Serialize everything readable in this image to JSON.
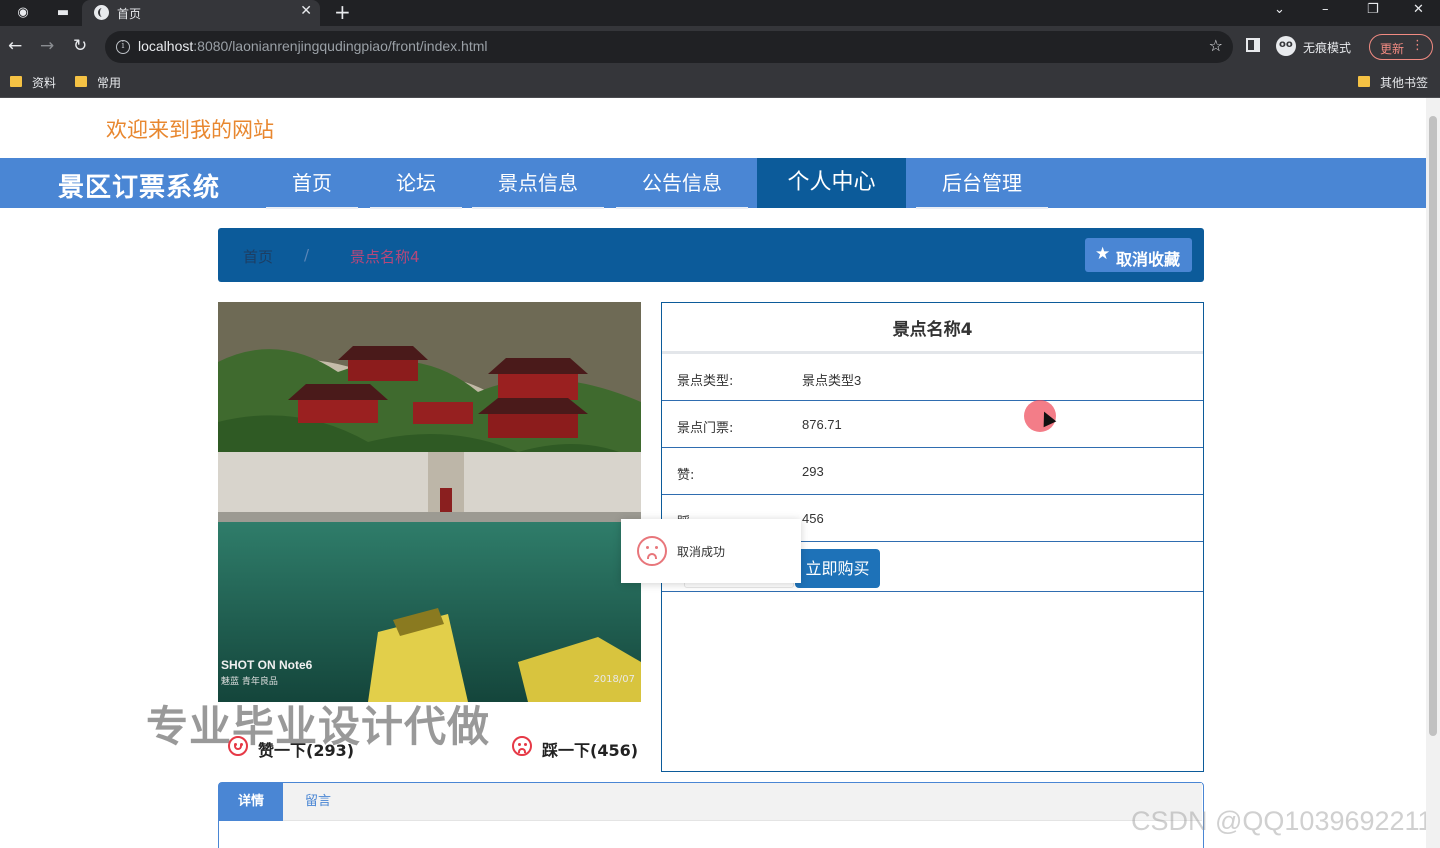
{
  "browser": {
    "tab_title": "首页",
    "url_host": "localhost",
    "url_path": ":8080/laonianrenjingqudingpiao/front/index.html",
    "incognito_label": "无痕模式",
    "update_label": "更新",
    "bookmarks": [
      "资料",
      "常用"
    ],
    "other_bookmarks": "其他书签"
  },
  "site": {
    "welcome": "欢迎来到我的网站",
    "brand": "景区订票系统",
    "nav": [
      "首页",
      "论坛",
      "景点信息",
      "公告信息",
      "个人中心",
      "后台管理"
    ],
    "active_nav": "个人中心"
  },
  "breadcrumb": {
    "home": "首页",
    "separator": "/",
    "current": "景点名称4"
  },
  "favorite_button": "取消收藏",
  "photo": {
    "caption": "SHOT ON Note6",
    "subcaption": "魅蓝 青年良品",
    "date": "2018/07"
  },
  "votes": {
    "like": "赞一下(293)",
    "dislike": "踩一下(456)"
  },
  "detail": {
    "title": "景点名称4",
    "rows": [
      {
        "label": "景点类型:",
        "value": "景点类型3"
      },
      {
        "label": "景点门票:",
        "value": "876.71"
      },
      {
        "label": "赞:",
        "value": "293"
      },
      {
        "label": "踩:",
        "value": "456"
      }
    ],
    "buy_button": "立即购买"
  },
  "toast": "取消成功",
  "tabs": [
    "详情",
    "留言"
  ],
  "watermark": "专业毕业设计代做",
  "csdn_watermark": "CSDN @QQ1039692211",
  "colors": {
    "nav_bar": "#4a86d4",
    "accent_dark": "#0c5b9a",
    "welcome_text": "#e8872f",
    "vote_icon": "#e63946"
  }
}
